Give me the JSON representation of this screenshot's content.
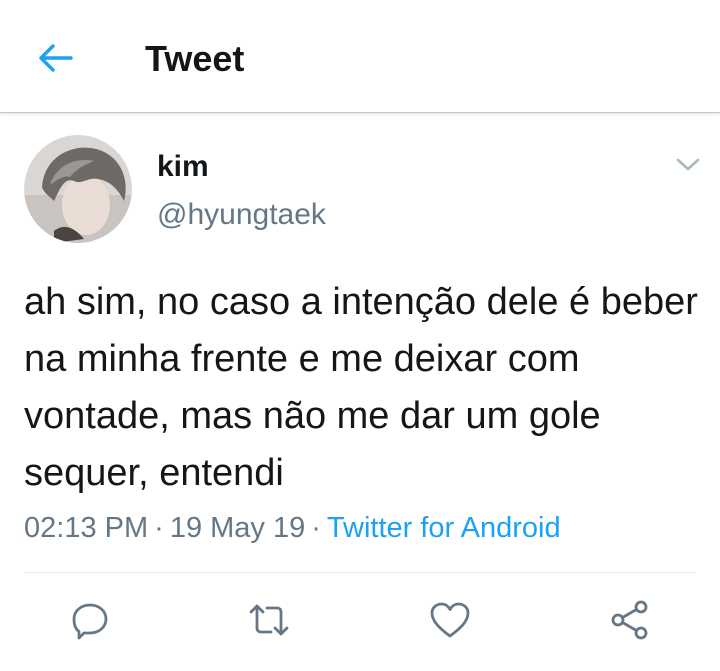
{
  "header": {
    "title": "Tweet",
    "back_icon": "arrow-left-icon"
  },
  "colors": {
    "accent": "#1da1f2",
    "secondary_text": "#657786",
    "primary_text": "#14171a",
    "icon_gray": "#657786"
  },
  "tweet": {
    "display_name": "kim",
    "handle": "@hyungtaek",
    "text": "ah sim, no caso a intenção dele é beber na minha frente e me deixar com vontade, mas não me dar um gole sequer, entendi",
    "time": "02:13 PM",
    "date": "19 May 19",
    "separator": "·",
    "source": "Twitter for Android"
  },
  "actions": [
    {
      "name": "reply",
      "icon": "reply-icon"
    },
    {
      "name": "retweet",
      "icon": "retweet-icon"
    },
    {
      "name": "like",
      "icon": "heart-icon"
    },
    {
      "name": "share",
      "icon": "share-icon"
    }
  ]
}
